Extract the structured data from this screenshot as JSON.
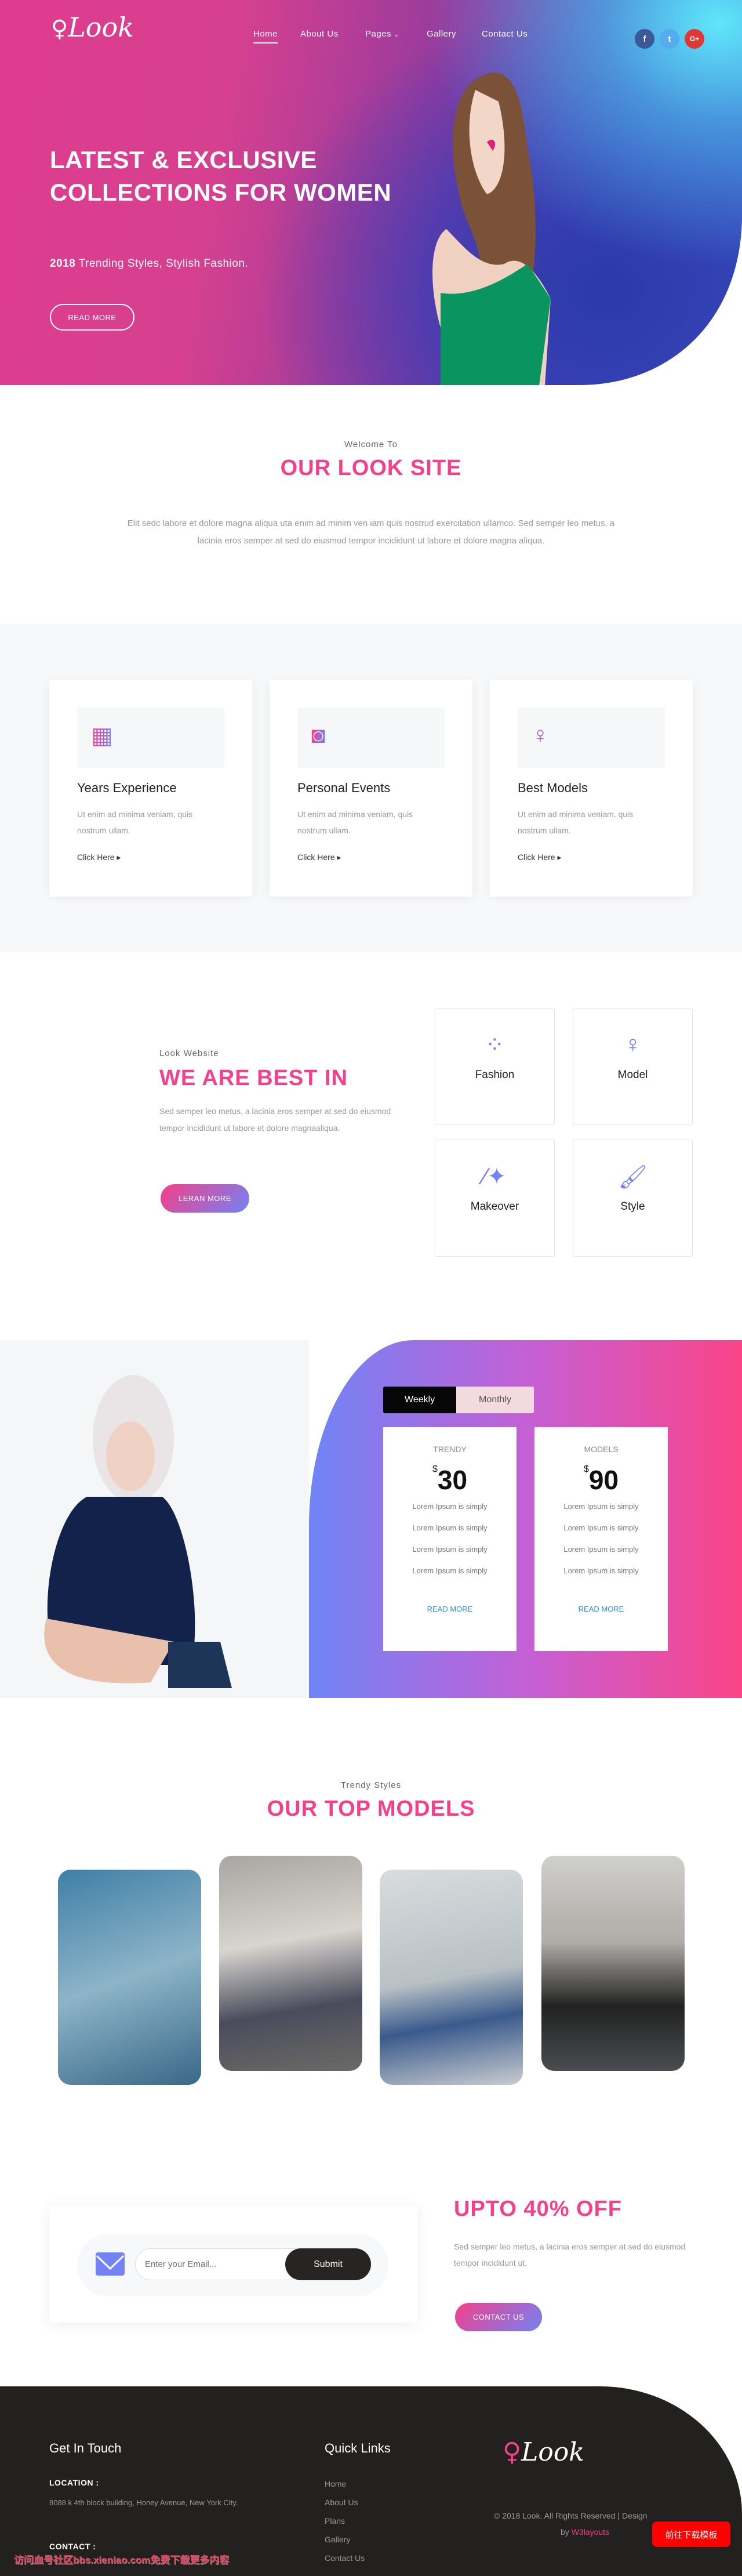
{
  "header": {
    "logo": "Look",
    "nav": [
      {
        "label": "Home",
        "active": true
      },
      {
        "label": "About Us"
      },
      {
        "label": "Pages"
      },
      {
        "label": "Gallery"
      },
      {
        "label": "Contact Us"
      }
    ],
    "social": [
      {
        "icon": "facebook-icon",
        "glyph": "f",
        "color": "#3b5998"
      },
      {
        "icon": "twitter-icon",
        "glyph": "t",
        "color": "#55acee"
      },
      {
        "icon": "google-plus-icon",
        "glyph": "G+",
        "color": "#dd3a36"
      }
    ]
  },
  "hero": {
    "title": "LATEST & EXCLUSIVE COLLECTIONS FOR WOMEN",
    "sub_year": "2018",
    "sub_text": " Trending Styles, Stylish Fashion.",
    "button": "READ MORE"
  },
  "welcome": {
    "eyebrow": "Welcome To",
    "title": "OUR LOOK SITE",
    "text": "Elit sedc labore et dolore magna aliqua uta enim ad minim ven iam quis nostrud exercitation ullamco. Sed semper leo metus, a lacinia eros semper at sed do eiusmod tempor incididunt ut labore et dolore magna aliqua."
  },
  "services": [
    {
      "icon": "calendar-icon",
      "title": "Years Experience",
      "text": "Ut enim ad minima veniam, quis nostrum ullam.",
      "link": "Click Here"
    },
    {
      "icon": "camera-icon",
      "title": "Personal Events",
      "text": "Ut enim ad minima veniam, quis nostrum ullam.",
      "link": "Click Here"
    },
    {
      "icon": "female-icon",
      "title": "Best Models",
      "text": "Ut enim ad minima veniam, quis nostrum ullam.",
      "link": "Click Here"
    }
  ],
  "best": {
    "eyebrow": "Look Website",
    "title": "WE ARE BEST IN",
    "text": "Sed semper leo metus, a lacinia eros semper at sed do eiusmod tempor incididunt ut labore et dolore magnaaliqua.",
    "button": "LERAN MORE",
    "features": [
      {
        "icon": "spinner-icon",
        "label": "Fashion"
      },
      {
        "icon": "female-icon",
        "label": "Model"
      },
      {
        "icon": "magic-wand-icon",
        "label": "Makeover"
      },
      {
        "icon": "paint-brush-icon",
        "label": "Style"
      }
    ]
  },
  "pricing": {
    "tabs": [
      {
        "label": "Weekly",
        "active": true
      },
      {
        "label": "Monthly"
      }
    ],
    "plans": [
      {
        "name": "TRENDY",
        "currency": "$",
        "price": "30",
        "items": [
          "Lorem Ipsum is simply",
          "Lorem Ipsum is simply",
          "Lorem Ipsum is simply",
          "Lorem Ipsum is simply"
        ],
        "link": "READ MORE"
      },
      {
        "name": "MODELS",
        "currency": "$",
        "price": "90",
        "items": [
          "Lorem Ipsum is simply",
          "Lorem Ipsum is simply",
          "Lorem Ipsum is simply",
          "Lorem Ipsum is simply"
        ],
        "link": "READ MORE"
      }
    ]
  },
  "models": {
    "eyebrow": "Trendy Styles",
    "title": "OUR TOP MODELS"
  },
  "newsletter": {
    "placeholder": "Enter your Email...",
    "submit": "Submit",
    "offer_title": "UPTO 40% OFF",
    "offer_text": "Sed semper leo metus, a lacinia eros semper at sed do eiusmod tempor incididunt ut.",
    "button": "CONTACT US"
  },
  "footer": {
    "touch_title": "Get In Touch",
    "location_label": "LOCATION :",
    "location": "8088 k 4th block building, Honey Avenue, New York City.",
    "contact_label": "CONTACT :",
    "links_title": "Quick Links",
    "links": [
      "Home",
      "About Us",
      "Plans",
      "Gallery",
      "Contact Us"
    ],
    "logo": "Look",
    "copyright": "© 2018 Look. All Rights Reserved | Design",
    "by": "by ",
    "credit": "W3layouts",
    "download_button": "前往下载模板",
    "watermark": "访问血号社区bbs.xieniao.com免费下载更多内容"
  },
  "colors": {
    "accent": "#f43f8a",
    "accent2": "#7382f4",
    "footer": "#232120"
  }
}
